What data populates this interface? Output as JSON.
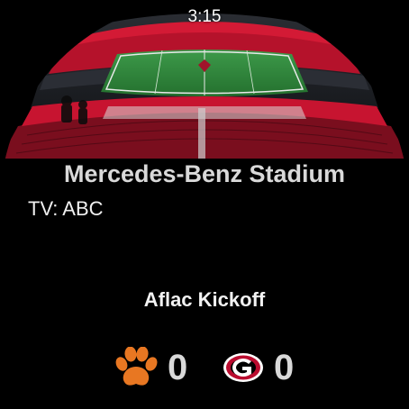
{
  "status_bar": {
    "time": "3:15"
  },
  "venue": {
    "name": "Mercedes-Benz Stadium",
    "image_icon": "stadium-photo"
  },
  "broadcast": {
    "text": "TV: ABC"
  },
  "event": {
    "name": "Aflac Kickoff"
  },
  "teams": [
    {
      "logo_icon": "tiger-paw-icon",
      "logo_color": "#E87722",
      "score": "0"
    },
    {
      "logo_icon": "g-logo-icon",
      "logo_color": "#BA0C2F",
      "score": "0"
    }
  ],
  "colors": {
    "background": "#000000",
    "stands": "#c0102a",
    "field": "#2f8a3a"
  }
}
